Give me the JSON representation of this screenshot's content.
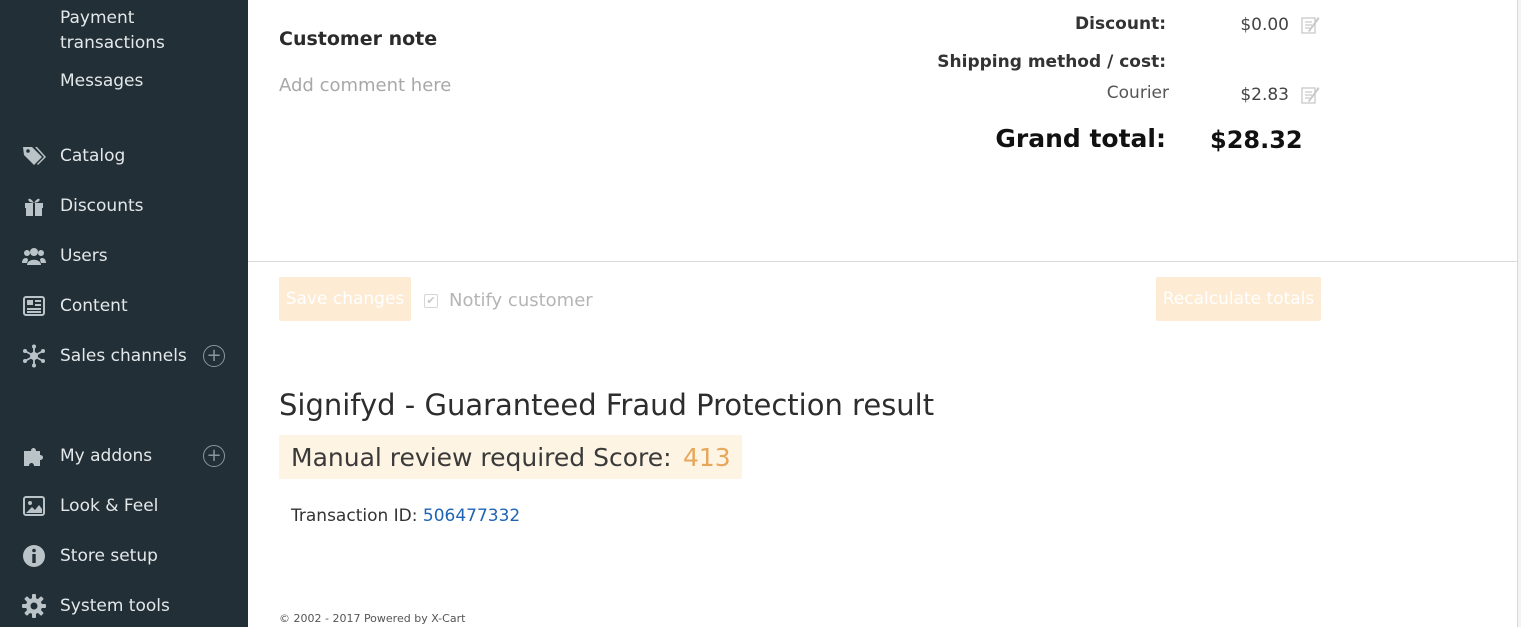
{
  "sidebar": {
    "sub_items": [
      {
        "label": "Payment transactions"
      },
      {
        "label": "Messages"
      }
    ],
    "items": [
      {
        "label": "Catalog",
        "icon": "tags-icon"
      },
      {
        "label": "Discounts",
        "icon": "gift-icon"
      },
      {
        "label": "Users",
        "icon": "users-icon"
      },
      {
        "label": "Content",
        "icon": "newspaper-icon"
      },
      {
        "label": "Sales channels",
        "icon": "hub-icon",
        "plus": "+"
      },
      {
        "label": "My addons",
        "icon": "puzzle-icon",
        "plus": "+"
      },
      {
        "label": "Look & Feel",
        "icon": "image-icon"
      },
      {
        "label": "Store setup",
        "icon": "info-icon"
      },
      {
        "label": "System tools",
        "icon": "gear-icon"
      }
    ]
  },
  "customer_note": {
    "title": "Customer note",
    "placeholder": "Add comment here"
  },
  "totals": {
    "discount_label": "Discount:",
    "discount_value": "$0.00",
    "shipping_label": "Shipping method / cost:",
    "shipping_method": "Courier",
    "shipping_value": "$2.83",
    "grand_total_label": "Grand total:",
    "grand_total_value": "$28.32"
  },
  "actions": {
    "save_label": "Save changes",
    "notify_label": "Notify customer",
    "notify_checked": true,
    "recalculate_label": "Recalculate totals"
  },
  "signifyd": {
    "title": "Signifyd - Guaranteed Fraud Protection result",
    "status_text": "Manual review required Score:",
    "score": "413",
    "transaction_label": "Transaction ID:",
    "transaction_id": "506477332"
  },
  "footer": {
    "text": "© 2002 - 2017 Powered by X-Cart"
  },
  "colors": {
    "sidebar_bg": "#232f36",
    "button_pale": "#fdebd3",
    "review_bg": "#fdf4e3",
    "score": "#e7a75b",
    "link": "#1f64b4"
  }
}
